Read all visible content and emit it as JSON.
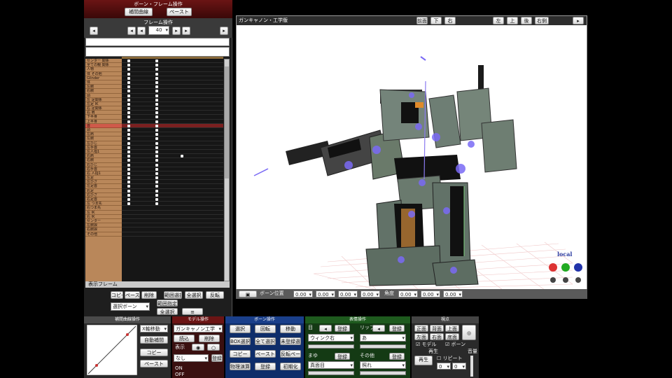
{
  "frame_panel": {
    "title": "ボーン・フレーム操作",
    "btn_left": "補間曲線",
    "btn_right": "ペースト",
    "sub_title": "フレーム操作",
    "frame_number": "40",
    "tracks": [
      "センター 関係",
      "全ての親 関係",
      "人物",
      "体 その他",
      "Glinder",
      "体",
      "左腕",
      "右腕",
      "頭",
      "左 足関係",
      "左足 IK",
      "右 足関係",
      "右 肩",
      "下半身",
      "上半身",
      "首",
      "頭",
      "左肩",
      "左腕",
      "左ひじ",
      "左手首",
      "左人指1",
      "右肩",
      "右腕",
      "右ひじ",
      "右手首",
      "右 人指1",
      "左足",
      "左ひざ",
      "左足首",
      "右足",
      "右ひざ",
      "右足首",
      "左 つま先",
      "右つま先",
      "左 IK",
      "右 IK",
      "センター",
      "左腕捩",
      "右腕捩",
      "その他"
    ],
    "highlight_index": 15,
    "bottom_btns": [
      "コピー",
      "ペースト",
      "削除",
      "範囲選択",
      "全選択",
      "反転"
    ],
    "bottom_select": "選択ボーン",
    "bottom_btn2": "範囲指定",
    "bottom_btn3": "全選択",
    "frame_label": "表示フレーム"
  },
  "viewport": {
    "title": "ガンキャノン・工学版",
    "top_buttons": [
      "前面",
      "下",
      "右",
      "左",
      "上",
      "後",
      "右側"
    ],
    "local_label": "local",
    "status_label": "ボーン位置",
    "status_values": [
      "0.00",
      "0.00",
      "0.00",
      "0.00",
      "0.00"
    ],
    "status_label2": "角度",
    "status_values2": [
      "0.00",
      "0.00",
      "0.00"
    ]
  },
  "interp_panel": {
    "title": "補間曲線操作",
    "select": "X軸移動",
    "btn_auto": "自動補間",
    "btn_copy": "コピー",
    "btn_paste": "ペースト"
  },
  "model_panel": {
    "title": "モデル操作",
    "select": "ガンキャノン工学",
    "btn_load": "読込",
    "btn_delete": "削除",
    "radio_label": "表示",
    "radio_on": "ON",
    "radio_off": "OFF",
    "select2": "なし",
    "btn_register": "登録"
  },
  "bone_panel": {
    "title": "ボーン操作",
    "btn_select": "選択",
    "btn_rotate": "回転",
    "btn_move": "移動",
    "btn_box": "BOX選択",
    "btn_allsel": "全て選択",
    "btn_unreg": "未登録選択",
    "btn_copy": "コピー",
    "btn_paste": "ペースト",
    "btn_reverse": "反転ペースト",
    "btn_physics": "物理演算",
    "btn_register": "登録",
    "btn_init": "初期化"
  },
  "facial_panel": {
    "title": "表情操作",
    "groups": [
      {
        "name": "目",
        "select": "ウィンク右",
        "name2": "リップ",
        "select2": "あ"
      },
      {
        "name": "まゆ",
        "select": "真面目",
        "name2": "その他",
        "select2": "照れ"
      }
    ],
    "btn_register": "登録"
  },
  "view_panel": {
    "title": "視点",
    "buttons": [
      "正面",
      "背面",
      "上面",
      "左面",
      "右面",
      "底面"
    ],
    "checkbox1": "モデル",
    "checkbox2": "ボーン",
    "play_title": "再生",
    "btn_play": "再生",
    "checkbox3": "リピート",
    "volume_title": "音量",
    "frame_from": "0",
    "frame_to": "0"
  }
}
